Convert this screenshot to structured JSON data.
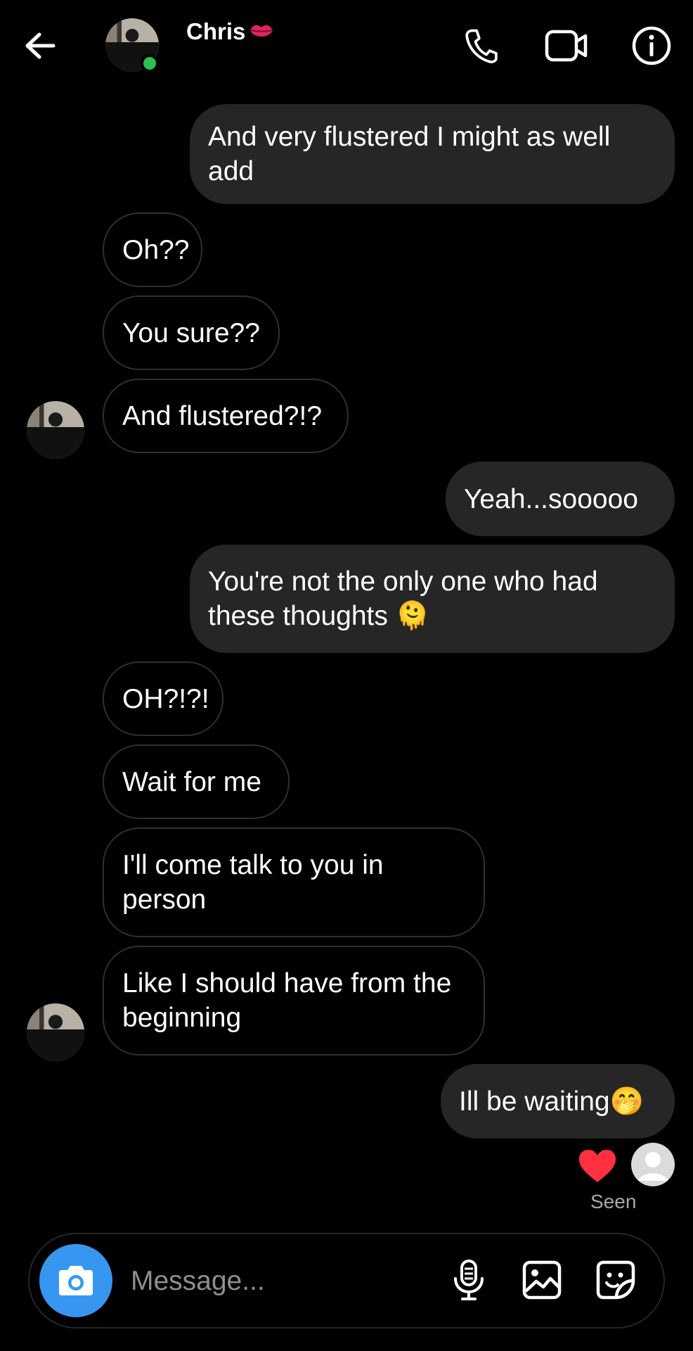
{
  "header": {
    "contact_name": "Chris",
    "contact_emoji": "lips-emoji",
    "online_color": "#2ec04f",
    "icons": [
      "back-arrow-icon",
      "phone-icon",
      "video-camera-icon",
      "info-icon"
    ]
  },
  "messages": [
    {
      "side": "sent",
      "text": "And very flustered I might as well add"
    },
    {
      "side": "received",
      "text": "Oh??"
    },
    {
      "side": "received",
      "text": "You sure??"
    },
    {
      "side": "received",
      "text": "And flustered?!?"
    },
    {
      "side": "sent",
      "text": "Yeah...sooooo"
    },
    {
      "side": "sent",
      "text": "You're not the only one who had these thoughts",
      "emoji": "🫠"
    },
    {
      "side": "received",
      "text": "OH?!?!"
    },
    {
      "side": "received",
      "text": "Wait for me"
    },
    {
      "side": "received",
      "text": "I'll come talk to you in person"
    },
    {
      "side": "received",
      "text": "Like I should have from the beginning"
    },
    {
      "side": "sent",
      "text": "Ill be waiting",
      "emoji": "🤭"
    }
  ],
  "status": {
    "reaction": "heart-icon",
    "reaction_color": "#ff3040",
    "seen_label": "Seen"
  },
  "composer": {
    "placeholder": "Message...",
    "camera_color": "#3797f0",
    "icons": [
      "camera-icon",
      "microphone-icon",
      "gallery-icon",
      "sticker-icon"
    ]
  }
}
